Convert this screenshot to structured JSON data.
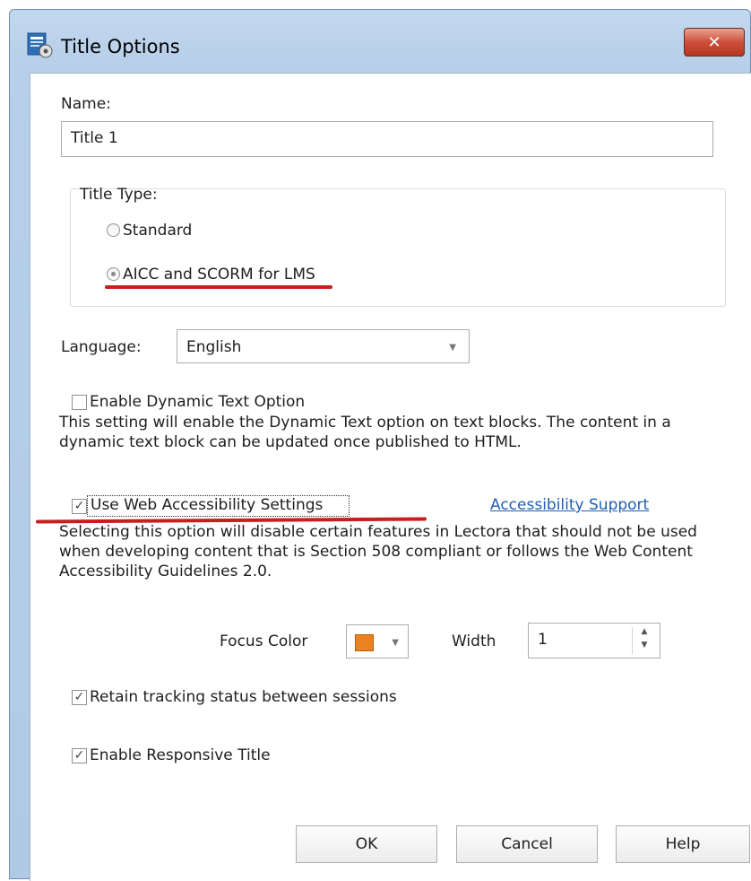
{
  "window": {
    "title": "Title Options",
    "close_icon": "close-icon",
    "app_icon": "title-options-icon"
  },
  "name": {
    "label": "Name:",
    "value": "Title 1"
  },
  "title_type": {
    "label": "Title Type:",
    "options": [
      {
        "label": "Standard",
        "selected": false
      },
      {
        "label": "AICC and SCORM for LMS",
        "selected": true
      }
    ]
  },
  "language": {
    "label": "Language:",
    "value": "English"
  },
  "dynamic_text": {
    "label": "Enable Dynamic Text Option",
    "checked": false,
    "description": "This setting will enable the Dynamic Text option on text blocks. The content in a dynamic text block can be updated once published to HTML."
  },
  "accessibility": {
    "label": "Use Web Accessibility Settings",
    "checked": true,
    "link": "Accessibility Support",
    "description": "Selecting this option will disable certain features in Lectora that should not be used when developing content that is Section 508 compliant or follows the Web Content Accessibility Guidelines 2.0.",
    "focus_color_label": "Focus Color",
    "focus_color": "#e9821f",
    "width_label": "Width",
    "width_value": "1"
  },
  "retain_tracking": {
    "label": "Retain tracking status between sessions",
    "checked": true
  },
  "responsive": {
    "label": "Enable Responsive Title",
    "checked": true
  },
  "buttons": {
    "ok": "OK",
    "cancel": "Cancel",
    "help": "Help"
  },
  "annotation_color": "#c81e1e"
}
